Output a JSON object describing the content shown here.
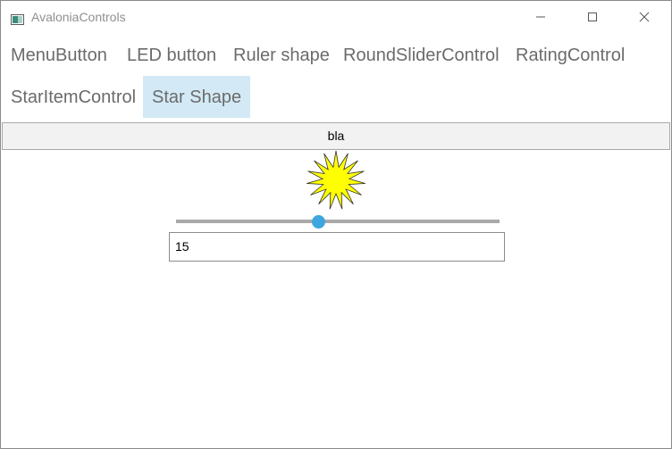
{
  "window": {
    "title": "AvaloniaControls"
  },
  "icons": {
    "app": "app-window-icon",
    "minimize": "minimize-icon",
    "maximize": "maximize-icon",
    "close": "close-icon",
    "star": "star-shape-icon"
  },
  "tabs": [
    {
      "label": "MenuButton",
      "selected": false
    },
    {
      "label": "LED button",
      "selected": false
    },
    {
      "label": "Ruler shape",
      "selected": false
    },
    {
      "label": "RoundSliderControl",
      "selected": false
    },
    {
      "label": "RatingControl",
      "selected": false
    },
    {
      "label": "StarItemControl",
      "selected": false
    },
    {
      "label": "Star Shape",
      "selected": true
    }
  ],
  "content": {
    "button_label": "bla",
    "slider": {
      "value_fraction": 0.44
    },
    "input_value": "15"
  },
  "colors": {
    "selected_tab_bg": "#d3eaf6",
    "slider_thumb": "#3da7dd",
    "star_fill": "#ffff00",
    "star_stroke": "#333333"
  }
}
